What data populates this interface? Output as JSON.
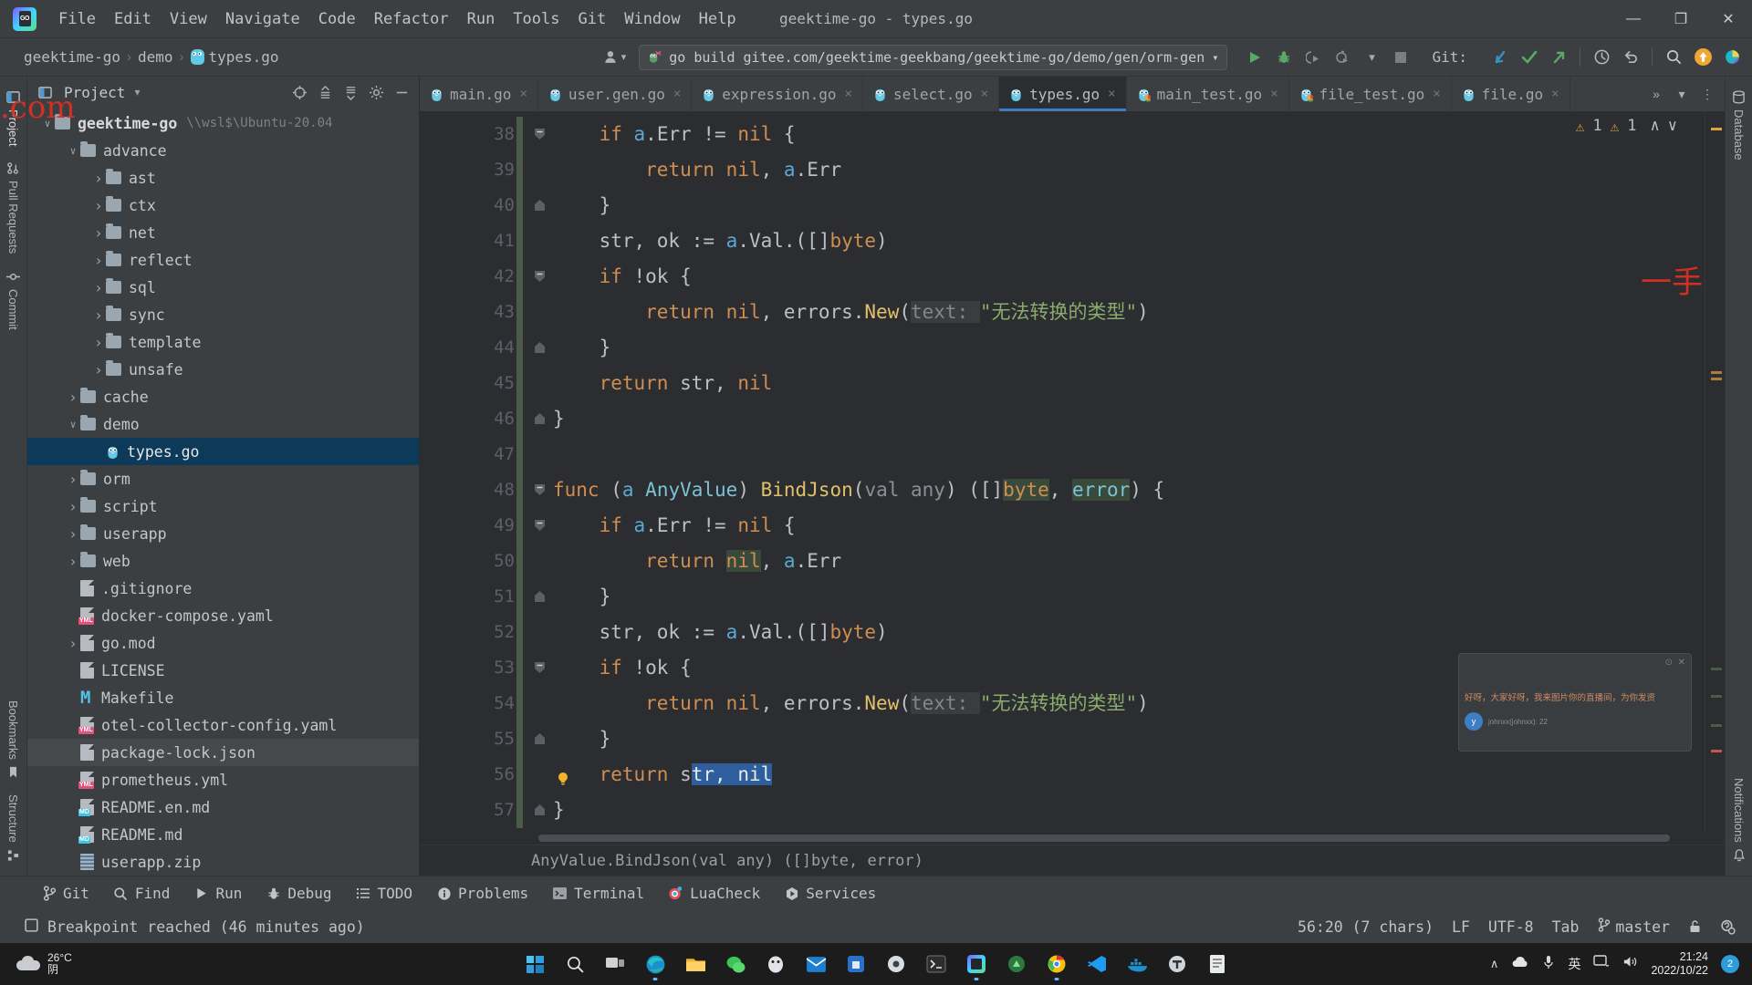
{
  "window": {
    "title": "geektime-go - types.go",
    "logo_icon": "goland-logo-icon",
    "minimize_label": "—",
    "maximize_label": "❐",
    "close_label": "✕"
  },
  "menu": {
    "items": [
      "File",
      "Edit",
      "View",
      "Navigate",
      "Code",
      "Refactor",
      "Run",
      "Tools",
      "Git",
      "Window",
      "Help"
    ]
  },
  "navbar": {
    "breadcrumbs": [
      {
        "label": "geektime-go",
        "icon": ""
      },
      {
        "label": "demo",
        "icon": ""
      },
      {
        "label": "types.go",
        "icon": "go-file-icon"
      }
    ],
    "separator": "›",
    "user_icon": "user-avatar-icon",
    "run_config": "go build gitee.com/geektime-geekbang/geektime-go/demo/gen/orm-gen",
    "run_config_dropdown": "▾",
    "run_icon": "run-play-icon",
    "debug_icon": "debug-bug-icon",
    "run_coverage_icon": "run-with-coverage-icon",
    "profiler_icon": "profiler-icon",
    "more_icon": "▾",
    "stop_icon": "stop-icon",
    "git_label": "Git:",
    "git_update_icon": "git-update-project-icon",
    "git_commit_icon": "git-commit-icon",
    "git_push_icon": "git-push-icon",
    "history_icon": "history-clock-icon",
    "rollback_icon": "rollback-undo-icon",
    "search_icon": "search-everywhere-icon",
    "update_badge_icon": "ide-update-icon",
    "plugin_icon": "plugin-colored-icon"
  },
  "left_rail": {
    "items": [
      {
        "label": "Project",
        "icon": "project-panel-icon",
        "active": true
      },
      {
        "label": "Pull Requests",
        "icon": "pull-requests-icon",
        "active": false
      },
      {
        "label": "Commit",
        "icon": "commit-icon",
        "active": false
      }
    ],
    "bottom_items": [
      {
        "label": "Bookmarks",
        "icon": "bookmarks-icon"
      },
      {
        "label": "Structure",
        "icon": "structure-icon"
      }
    ]
  },
  "right_rail": {
    "items": [
      {
        "label": "Database",
        "icon": "database-icon"
      },
      {
        "label": "Notifications",
        "icon": "notifications-icon"
      }
    ]
  },
  "project_panel": {
    "title": "Project",
    "title_dropdown": "▾",
    "icons": [
      {
        "name": "scroll-from-source-icon",
        "glyph": "⊕"
      },
      {
        "name": "expand-all-icon",
        "glyph": "⇵"
      },
      {
        "name": "collapse-all-icon",
        "glyph": "⇶"
      },
      {
        "name": "settings-gear-icon",
        "glyph": "⚙"
      },
      {
        "name": "hide-panel-icon",
        "glyph": "—"
      }
    ],
    "tree": [
      {
        "label": "geektime-go",
        "type": "folder",
        "depth": 0,
        "expanded": true,
        "bold": true,
        "path": "\\\\wsl$\\Ubuntu-20.04"
      },
      {
        "label": "advance",
        "type": "folder",
        "depth": 1,
        "expanded": true
      },
      {
        "label": "ast",
        "type": "folder",
        "depth": 2,
        "expanded": false
      },
      {
        "label": "ctx",
        "type": "folder",
        "depth": 2,
        "expanded": false
      },
      {
        "label": "net",
        "type": "folder",
        "depth": 2,
        "expanded": false
      },
      {
        "label": "reflect",
        "type": "folder",
        "depth": 2,
        "expanded": false
      },
      {
        "label": "sql",
        "type": "folder",
        "depth": 2,
        "expanded": false
      },
      {
        "label": "sync",
        "type": "folder",
        "depth": 2,
        "expanded": false
      },
      {
        "label": "template",
        "type": "folder",
        "depth": 2,
        "expanded": false
      },
      {
        "label": "unsafe",
        "type": "folder",
        "depth": 2,
        "expanded": false
      },
      {
        "label": "cache",
        "type": "folder",
        "depth": 1,
        "expanded": false
      },
      {
        "label": "demo",
        "type": "folder",
        "depth": 1,
        "expanded": true
      },
      {
        "label": "types.go",
        "type": "go",
        "depth": 2,
        "selected": true
      },
      {
        "label": "orm",
        "type": "folder",
        "depth": 1,
        "expanded": false
      },
      {
        "label": "script",
        "type": "folder",
        "depth": 1,
        "expanded": false
      },
      {
        "label": "userapp",
        "type": "folder",
        "depth": 1,
        "expanded": false
      },
      {
        "label": "web",
        "type": "folder",
        "depth": 1,
        "expanded": false
      },
      {
        "label": ".gitignore",
        "type": "file",
        "depth": 1
      },
      {
        "label": "docker-compose.yaml",
        "type": "yml",
        "depth": 1
      },
      {
        "label": "go.mod",
        "type": "file",
        "depth": 1,
        "expandable": true
      },
      {
        "label": "LICENSE",
        "type": "file",
        "depth": 1
      },
      {
        "label": "Makefile",
        "type": "makefile",
        "depth": 1
      },
      {
        "label": "otel-collector-config.yaml",
        "type": "yml",
        "depth": 1
      },
      {
        "label": "package-lock.json",
        "type": "file",
        "depth": 1,
        "hovered": true
      },
      {
        "label": "prometheus.yml",
        "type": "yml",
        "depth": 1
      },
      {
        "label": "README.en.md",
        "type": "md",
        "depth": 1
      },
      {
        "label": "README.md",
        "type": "md",
        "depth": 1
      },
      {
        "label": "userapp.zip",
        "type": "zip",
        "depth": 1
      }
    ]
  },
  "editor": {
    "tabs": [
      {
        "label": "main.go",
        "icon": "go-file-icon",
        "active": false
      },
      {
        "label": "user.gen.go",
        "icon": "go-file-icon",
        "active": false
      },
      {
        "label": "expression.go",
        "icon": "go-file-icon",
        "active": false
      },
      {
        "label": "select.go",
        "icon": "go-file-icon",
        "active": false
      },
      {
        "label": "types.go",
        "icon": "go-file-icon",
        "active": true
      },
      {
        "label": "main_test.go",
        "icon": "go-test-file-icon",
        "active": false
      },
      {
        "label": "file_test.go",
        "icon": "go-test-file-icon",
        "active": false
      },
      {
        "label": "file.go",
        "icon": "go-file-icon",
        "active": false
      }
    ],
    "tab_close_glyph": "×",
    "tabs_overflow_icon": "»",
    "tabs_list_icon": "▾",
    "tabs_options_icon": "⋮",
    "inspection_warnings": "1",
    "inspection_weak_warnings": "1",
    "warning_icon": "warning-triangle-icon",
    "prev_problem_icon": "∧",
    "next_problem_icon": "∨",
    "breadcrumb_bottom": "AnyValue.BindJson(val any) ([]byte, error)",
    "lines": [
      {
        "n": 38,
        "fold": "minus",
        "tokens": [
          {
            "t": "    ",
            "c": "punct"
          },
          {
            "t": "if ",
            "c": "kw"
          },
          {
            "t": "a",
            "c": "recv"
          },
          {
            "t": ".Err ",
            "c": "punct"
          },
          {
            "t": "!= ",
            "c": "punct"
          },
          {
            "t": "nil",
            "c": "kw"
          },
          {
            "t": " {",
            "c": "punct"
          }
        ]
      },
      {
        "n": 39,
        "tokens": [
          {
            "t": "        ",
            "c": "punct"
          },
          {
            "t": "return ",
            "c": "kw"
          },
          {
            "t": "nil",
            "c": "kw"
          },
          {
            "t": ", ",
            "c": "punct"
          },
          {
            "t": "a",
            "c": "recv"
          },
          {
            "t": ".Err",
            "c": "punct"
          }
        ]
      },
      {
        "n": 40,
        "fold": "end",
        "tokens": [
          {
            "t": "    }",
            "c": "punct"
          }
        ]
      },
      {
        "n": 41,
        "tokens": [
          {
            "t": "    str, ok ",
            "c": "punct"
          },
          {
            "t": ":= ",
            "c": "punct"
          },
          {
            "t": "a",
            "c": "recv"
          },
          {
            "t": ".Val.([]",
            "c": "punct"
          },
          {
            "t": "byte",
            "c": "kw"
          },
          {
            "t": ")",
            "c": "punct"
          }
        ]
      },
      {
        "n": 42,
        "fold": "minus",
        "tokens": [
          {
            "t": "    ",
            "c": "punct"
          },
          {
            "t": "if ",
            "c": "kw"
          },
          {
            "t": "!ok {",
            "c": "punct"
          }
        ]
      },
      {
        "n": 43,
        "tokens": [
          {
            "t": "        ",
            "c": "punct"
          },
          {
            "t": "return ",
            "c": "kw"
          },
          {
            "t": "nil",
            "c": "kw"
          },
          {
            "t": ", errors.",
            "c": "punct"
          },
          {
            "t": "New",
            "c": "fn"
          },
          {
            "t": "(",
            "c": "punct"
          },
          {
            "t": "text: ",
            "c": "hint"
          },
          {
            "t": "\"无法转换的类型\"",
            "c": "str"
          },
          {
            "t": ")",
            "c": "punct"
          }
        ]
      },
      {
        "n": 44,
        "fold": "end",
        "tokens": [
          {
            "t": "    }",
            "c": "punct"
          }
        ]
      },
      {
        "n": 45,
        "tokens": [
          {
            "t": "    ",
            "c": "punct"
          },
          {
            "t": "return ",
            "c": "kw"
          },
          {
            "t": "str, ",
            "c": "punct"
          },
          {
            "t": "nil",
            "c": "kw"
          }
        ]
      },
      {
        "n": 46,
        "fold": "end",
        "tokens": [
          {
            "t": "}",
            "c": "punct"
          }
        ]
      },
      {
        "n": 47,
        "tokens": []
      },
      {
        "n": 48,
        "fold": "minus",
        "tokens": [
          {
            "t": "func ",
            "c": "kw"
          },
          {
            "t": "(",
            "c": "punct"
          },
          {
            "t": "a ",
            "c": "recv"
          },
          {
            "t": "AnyValue",
            "c": "typ"
          },
          {
            "t": ") ",
            "c": "punct"
          },
          {
            "t": "BindJson",
            "c": "fn"
          },
          {
            "t": "(",
            "c": "punct"
          },
          {
            "t": "val any",
            "c": "param"
          },
          {
            "t": ") ([]",
            "c": "punct"
          },
          {
            "t": "byte",
            "c": "kwhl"
          },
          {
            "t": ", ",
            "c": "punct"
          },
          {
            "t": "error",
            "c": "typhl"
          },
          {
            "t": ") {",
            "c": "punct"
          }
        ]
      },
      {
        "n": 49,
        "fold": "minus",
        "tokens": [
          {
            "t": "    ",
            "c": "punct"
          },
          {
            "t": "if ",
            "c": "kw"
          },
          {
            "t": "a",
            "c": "recv"
          },
          {
            "t": ".Err ",
            "c": "punct"
          },
          {
            "t": "!= ",
            "c": "punct"
          },
          {
            "t": "nil",
            "c": "kw"
          },
          {
            "t": " {",
            "c": "punct"
          }
        ]
      },
      {
        "n": 50,
        "tokens": [
          {
            "t": "        ",
            "c": "punct"
          },
          {
            "t": "return ",
            "c": "kw"
          },
          {
            "t": "nil",
            "c": "kwhl"
          },
          {
            "t": ", ",
            "c": "punct"
          },
          {
            "t": "a",
            "c": "recv"
          },
          {
            "t": ".Err",
            "c": "punct"
          }
        ]
      },
      {
        "n": 51,
        "fold": "end",
        "tokens": [
          {
            "t": "    }",
            "c": "punct"
          }
        ]
      },
      {
        "n": 52,
        "tokens": [
          {
            "t": "    str, ok ",
            "c": "punct"
          },
          {
            "t": ":= ",
            "c": "punct"
          },
          {
            "t": "a",
            "c": "recv"
          },
          {
            "t": ".Val.([]",
            "c": "punct"
          },
          {
            "t": "byte",
            "c": "kw"
          },
          {
            "t": ")",
            "c": "punct"
          }
        ]
      },
      {
        "n": 53,
        "fold": "minus",
        "tokens": [
          {
            "t": "    ",
            "c": "punct"
          },
          {
            "t": "if ",
            "c": "kw"
          },
          {
            "t": "!ok {",
            "c": "punct"
          }
        ]
      },
      {
        "n": 54,
        "tokens": [
          {
            "t": "        ",
            "c": "punct"
          },
          {
            "t": "return ",
            "c": "kw"
          },
          {
            "t": "nil",
            "c": "kw"
          },
          {
            "t": ", errors.",
            "c": "punct"
          },
          {
            "t": "New",
            "c": "fn"
          },
          {
            "t": "(",
            "c": "punct"
          },
          {
            "t": "text: ",
            "c": "hint"
          },
          {
            "t": "\"无法转换的类型\"",
            "c": "str"
          },
          {
            "t": ")",
            "c": "punct"
          }
        ]
      },
      {
        "n": 55,
        "fold": "end",
        "tokens": [
          {
            "t": "    }",
            "c": "punct"
          }
        ]
      },
      {
        "n": 56,
        "bulb": true,
        "tokens": [
          {
            "t": "    ",
            "c": "punct"
          },
          {
            "t": "return ",
            "c": "kw"
          },
          {
            "t": "s",
            "c": "punct"
          },
          {
            "t": "tr, nil",
            "c": "sel"
          }
        ]
      },
      {
        "n": 57,
        "fold": "end",
        "tokens": [
          {
            "t": "}",
            "c": "punct"
          }
        ]
      }
    ]
  },
  "chat_popup": {
    "message": "好呀，大家好呀，我来图片你的直播间，为你发资",
    "user_name": "johnxx(johnxx): 22",
    "avatar_initial": "y",
    "close_glyph": "✕",
    "minimize_glyph": "⊙"
  },
  "tool_windows": {
    "items": [
      {
        "label": "Git",
        "icon": "git-branch-icon"
      },
      {
        "label": "Find",
        "icon": "find-search-icon"
      },
      {
        "label": "Run",
        "icon": "run-play-icon"
      },
      {
        "label": "Debug",
        "icon": "debug-bug-icon"
      },
      {
        "label": "TODO",
        "icon": "todo-list-icon"
      },
      {
        "label": "Problems",
        "icon": "problems-info-icon"
      },
      {
        "label": "Terminal",
        "icon": "terminal-icon"
      },
      {
        "label": "LuaCheck",
        "icon": "luacheck-icon"
      },
      {
        "label": "Services",
        "icon": "services-icon"
      }
    ]
  },
  "status_bar": {
    "message": "Breakpoint reached (46 minutes ago)",
    "message_icon": "breakpoint-reached-icon",
    "caret_position": "56:20 (7 chars)",
    "line_separator": "LF",
    "encoding": "UTF-8",
    "indent": "Tab",
    "branch": "master",
    "branch_icon": "git-branch-icon",
    "lock_icon": "read-only-lock-icon",
    "inspection_icon": "inspection-level-icon"
  },
  "taskbar": {
    "weather_temp": "26°C",
    "weather_desc": "阴",
    "weather_icon": "cloud-icon",
    "apps": [
      {
        "name": "start-button-icon"
      },
      {
        "name": "taskbar-search-icon"
      },
      {
        "name": "task-view-icon"
      },
      {
        "name": "edge-browser-icon"
      },
      {
        "name": "file-explorer-icon"
      },
      {
        "name": "wechat-icon"
      },
      {
        "name": "qq-icon"
      },
      {
        "name": "mail-icon"
      },
      {
        "name": "store-icon"
      },
      {
        "name": "settings-icon"
      },
      {
        "name": "terminal-app-icon"
      },
      {
        "name": "goland-app-icon"
      },
      {
        "name": "navicat-icon"
      },
      {
        "name": "chrome-icon"
      },
      {
        "name": "vscode-icon"
      },
      {
        "name": "docker-icon"
      },
      {
        "name": "typora-icon"
      },
      {
        "name": "notepad-icon"
      }
    ],
    "tray": [
      {
        "name": "show-hidden-icons-chevron",
        "glyph": "∧"
      },
      {
        "name": "onedrive-cloud-icon"
      },
      {
        "name": "microphone-icon"
      },
      {
        "name": "ime-language-icon",
        "glyph": "英"
      },
      {
        "name": "network-display-icon"
      },
      {
        "name": "volume-icon"
      }
    ],
    "clock_time": "21:24",
    "clock_date": "2022/10/22",
    "notification_count": "2"
  },
  "watermark": {
    "left_text": ".com",
    "right_text": "一手"
  },
  "colors": {
    "accent_blue": "#3d7ec4",
    "panel_bg": "#3c3f41",
    "editor_bg": "#2b2d30",
    "keyword_orange": "#cf8e51",
    "function_yellow": "#e0c06a",
    "type_teal": "#7cc2d4",
    "string_green": "#8aab6d",
    "selection_blue": "#2e5e9e",
    "warning_yellow": "#d9a43b",
    "taskbar_bg": "#1c1c1c"
  }
}
